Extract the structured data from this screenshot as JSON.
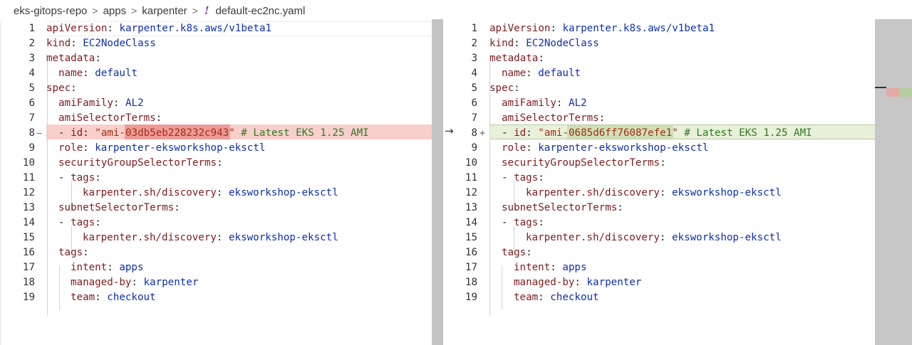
{
  "breadcrumb": {
    "repo": "eks-gitops-repo",
    "folder1": "apps",
    "folder2": "karpenter",
    "separator": ">",
    "file_icon": "!",
    "file": "default-ec2nc.yaml"
  },
  "compare_arrow": "→",
  "left": {
    "lines": [
      {
        "n": "1",
        "g": "",
        "indent": 0,
        "parts": [
          [
            "k",
            "apiVersion"
          ],
          [
            "p",
            ": "
          ],
          [
            "v",
            "karpenter.k8s.aws/v1beta1"
          ]
        ]
      },
      {
        "n": "2",
        "g": "",
        "indent": 0,
        "parts": [
          [
            "k",
            "kind"
          ],
          [
            "p",
            ": "
          ],
          [
            "v",
            "EC2NodeClass"
          ]
        ]
      },
      {
        "n": "3",
        "g": "",
        "indent": 0,
        "parts": [
          [
            "k",
            "metadata"
          ],
          [
            "p",
            ":"
          ]
        ]
      },
      {
        "n": "4",
        "g": "",
        "indent": 1,
        "parts": [
          [
            "k",
            "name"
          ],
          [
            "p",
            ": "
          ],
          [
            "v",
            "default"
          ]
        ]
      },
      {
        "n": "5",
        "g": "",
        "indent": 0,
        "parts": [
          [
            "k",
            "spec"
          ],
          [
            "p",
            ":"
          ]
        ]
      },
      {
        "n": "6",
        "g": "",
        "indent": 1,
        "parts": [
          [
            "k",
            "amiFamily"
          ],
          [
            "p",
            ": "
          ],
          [
            "v",
            "AL2"
          ]
        ]
      },
      {
        "n": "7",
        "g": "",
        "indent": 1,
        "parts": [
          [
            "k",
            "amiSelectorTerms"
          ],
          [
            "p",
            ":"
          ]
        ]
      },
      {
        "n": "8",
        "g": "—",
        "indent": 1,
        "parts": [
          [
            "p",
            "- "
          ],
          [
            "k",
            "id"
          ],
          [
            "p",
            ": "
          ],
          [
            "s",
            "\"ami-03db5eb228232c943\""
          ],
          [
            "p",
            " "
          ],
          [
            "c",
            "# Latest EKS 1.25 AMI"
          ]
        ]
      },
      {
        "n": "9",
        "g": "",
        "indent": 1,
        "parts": [
          [
            "k",
            "role"
          ],
          [
            "p",
            ": "
          ],
          [
            "v",
            "karpenter-eksworkshop-eksctl"
          ]
        ]
      },
      {
        "n": "10",
        "g": "",
        "indent": 1,
        "parts": [
          [
            "k",
            "securityGroupSelectorTerms"
          ],
          [
            "p",
            ":"
          ]
        ]
      },
      {
        "n": "11",
        "g": "",
        "indent": 1,
        "parts": [
          [
            "p",
            "- "
          ],
          [
            "k",
            "tags"
          ],
          [
            "p",
            ":"
          ]
        ]
      },
      {
        "n": "12",
        "g": "",
        "indent": 3,
        "parts": [
          [
            "k",
            "karpenter.sh/discovery"
          ],
          [
            "p",
            ": "
          ],
          [
            "v",
            "eksworkshop-eksctl"
          ]
        ]
      },
      {
        "n": "13",
        "g": "",
        "indent": 1,
        "parts": [
          [
            "k",
            "subnetSelectorTerms"
          ],
          [
            "p",
            ":"
          ]
        ]
      },
      {
        "n": "14",
        "g": "",
        "indent": 1,
        "parts": [
          [
            "p",
            "- "
          ],
          [
            "k",
            "tags"
          ],
          [
            "p",
            ":"
          ]
        ]
      },
      {
        "n": "15",
        "g": "",
        "indent": 3,
        "parts": [
          [
            "k",
            "karpenter.sh/discovery"
          ],
          [
            "p",
            ": "
          ],
          [
            "v",
            "eksworkshop-eksctl"
          ]
        ]
      },
      {
        "n": "16",
        "g": "",
        "indent": 1,
        "parts": [
          [
            "k",
            "tags"
          ],
          [
            "p",
            ":"
          ]
        ]
      },
      {
        "n": "17",
        "g": "",
        "indent": 2,
        "parts": [
          [
            "k",
            "intent"
          ],
          [
            "p",
            ": "
          ],
          [
            "v",
            "apps"
          ]
        ]
      },
      {
        "n": "18",
        "g": "",
        "indent": 2,
        "parts": [
          [
            "k",
            "managed-by"
          ],
          [
            "p",
            ": "
          ],
          [
            "v",
            "karpenter"
          ]
        ]
      },
      {
        "n": "19",
        "g": "",
        "indent": 2,
        "parts": [
          [
            "k",
            "team"
          ],
          [
            "p",
            ": "
          ],
          [
            "v",
            "checkout"
          ]
        ]
      }
    ]
  },
  "right": {
    "lines": [
      {
        "n": "1",
        "g": "",
        "indent": 0,
        "parts": [
          [
            "k",
            "apiVersion"
          ],
          [
            "p",
            ": "
          ],
          [
            "v",
            "karpenter.k8s.aws/v1beta1"
          ]
        ]
      },
      {
        "n": "2",
        "g": "",
        "indent": 0,
        "parts": [
          [
            "k",
            "kind"
          ],
          [
            "p",
            ": "
          ],
          [
            "v",
            "EC2NodeClass"
          ]
        ]
      },
      {
        "n": "3",
        "g": "",
        "indent": 0,
        "parts": [
          [
            "k",
            "metadata"
          ],
          [
            "p",
            ":"
          ]
        ]
      },
      {
        "n": "4",
        "g": "",
        "indent": 1,
        "parts": [
          [
            "k",
            "name"
          ],
          [
            "p",
            ": "
          ],
          [
            "v",
            "default"
          ]
        ]
      },
      {
        "n": "5",
        "g": "",
        "indent": 0,
        "parts": [
          [
            "k",
            "spec"
          ],
          [
            "p",
            ":"
          ]
        ]
      },
      {
        "n": "6",
        "g": "",
        "indent": 1,
        "parts": [
          [
            "k",
            "amiFamily"
          ],
          [
            "p",
            ": "
          ],
          [
            "v",
            "AL2"
          ]
        ]
      },
      {
        "n": "7",
        "g": "",
        "indent": 1,
        "parts": [
          [
            "k",
            "amiSelectorTerms"
          ],
          [
            "p",
            ":"
          ]
        ]
      },
      {
        "n": "8",
        "g": "+",
        "indent": 1,
        "parts": [
          [
            "p",
            "- "
          ],
          [
            "k",
            "id"
          ],
          [
            "p",
            ": "
          ],
          [
            "s",
            "\"ami-0685d6ff76087efe1\""
          ],
          [
            "p",
            " "
          ],
          [
            "c",
            "# Latest EKS 1.25 AMI"
          ]
        ]
      },
      {
        "n": "9",
        "g": "",
        "indent": 1,
        "parts": [
          [
            "k",
            "role"
          ],
          [
            "p",
            ": "
          ],
          [
            "v",
            "karpenter-eksworkshop-eksctl"
          ]
        ]
      },
      {
        "n": "10",
        "g": "",
        "indent": 1,
        "parts": [
          [
            "k",
            "securityGroupSelectorTerms"
          ],
          [
            "p",
            ":"
          ]
        ]
      },
      {
        "n": "11",
        "g": "",
        "indent": 1,
        "parts": [
          [
            "p",
            "- "
          ],
          [
            "k",
            "tags"
          ],
          [
            "p",
            ":"
          ]
        ]
      },
      {
        "n": "12",
        "g": "",
        "indent": 3,
        "parts": [
          [
            "k",
            "karpenter.sh/discovery"
          ],
          [
            "p",
            ": "
          ],
          [
            "v",
            "eksworkshop-eksctl"
          ]
        ]
      },
      {
        "n": "13",
        "g": "",
        "indent": 1,
        "parts": [
          [
            "k",
            "subnetSelectorTerms"
          ],
          [
            "p",
            ":"
          ]
        ]
      },
      {
        "n": "14",
        "g": "",
        "indent": 1,
        "parts": [
          [
            "p",
            "- "
          ],
          [
            "k",
            "tags"
          ],
          [
            "p",
            ":"
          ]
        ]
      },
      {
        "n": "15",
        "g": "",
        "indent": 3,
        "parts": [
          [
            "k",
            "karpenter.sh/discovery"
          ],
          [
            "p",
            ": "
          ],
          [
            "v",
            "eksworkshop-eksctl"
          ]
        ]
      },
      {
        "n": "16",
        "g": "",
        "indent": 1,
        "parts": [
          [
            "k",
            "tags"
          ],
          [
            "p",
            ":"
          ]
        ]
      },
      {
        "n": "17",
        "g": "",
        "indent": 2,
        "parts": [
          [
            "k",
            "intent"
          ],
          [
            "p",
            ": "
          ],
          [
            "v",
            "apps"
          ]
        ]
      },
      {
        "n": "18",
        "g": "",
        "indent": 2,
        "parts": [
          [
            "k",
            "managed-by"
          ],
          [
            "p",
            ": "
          ],
          [
            "v",
            "karpenter"
          ]
        ]
      },
      {
        "n": "19",
        "g": "",
        "indent": 2,
        "parts": [
          [
            "k",
            "team"
          ],
          [
            "p",
            ": "
          ],
          [
            "v",
            "checkout"
          ]
        ]
      }
    ]
  },
  "colors": {
    "key": "#7f1c1c",
    "value": "#0f2fb0",
    "string": "#a32d16",
    "comment": "#2d7a22",
    "deleted_line": "#f8cfcc",
    "added_line": "#e8f0d9"
  }
}
